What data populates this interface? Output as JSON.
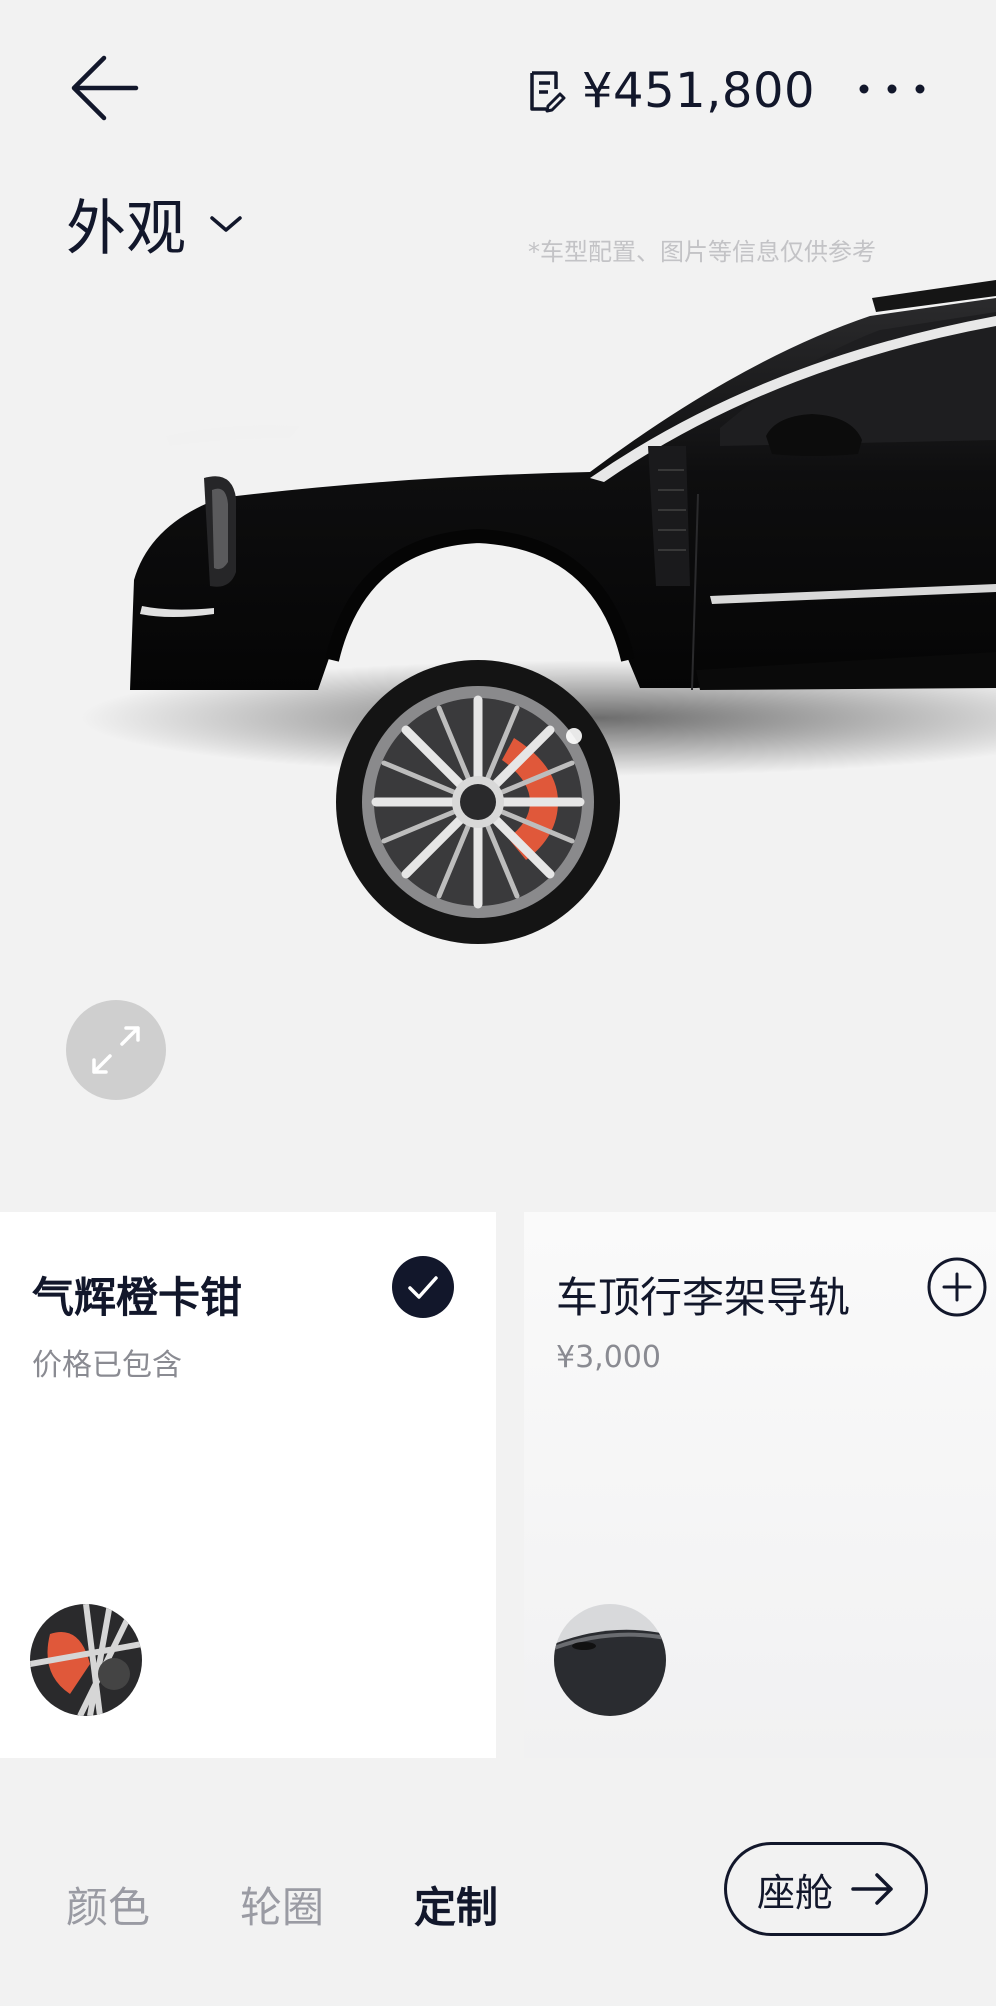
{
  "header": {
    "price": "¥451,800"
  },
  "section": {
    "title": "外观",
    "disclaimer": "*车型配置、图片等信息仅供参考"
  },
  "options": [
    {
      "title": "气辉橙卡钳",
      "subtitle": "价格已包含",
      "selected": true
    },
    {
      "title": "车顶行李架导轨",
      "subtitle": "¥3,000",
      "selected": false
    }
  ],
  "tabs": [
    {
      "label": "颜色",
      "active": false
    },
    {
      "label": "轮圈",
      "active": false
    },
    {
      "label": "定制",
      "active": true
    }
  ],
  "next_button": {
    "label": "座舱"
  },
  "colors": {
    "primary": "#12172b",
    "inactive_tab": "#9a9ba3",
    "caliper": "#e0583a",
    "background": "#f2f2f2"
  }
}
